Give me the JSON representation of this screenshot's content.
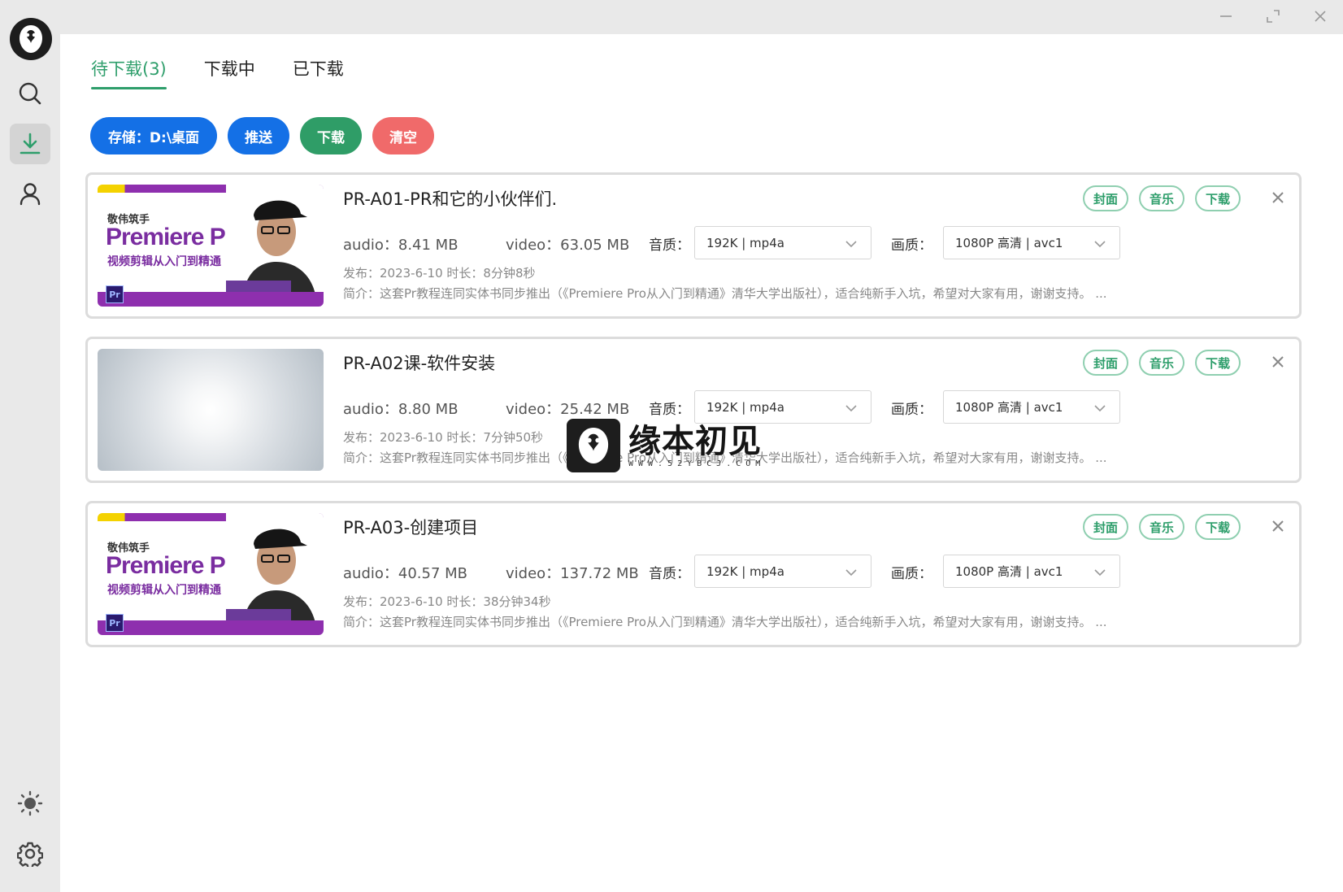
{
  "window": {
    "minimize_icon": "minimize-icon",
    "maximize_icon": "maximize-icon",
    "close_icon": "close-icon"
  },
  "sidebar": {
    "items": [
      {
        "name": "search",
        "icon": "search-icon"
      },
      {
        "name": "download",
        "icon": "download-icon",
        "active": true
      },
      {
        "name": "user",
        "icon": "user-icon"
      },
      {
        "name": "theme",
        "icon": "sun-icon"
      },
      {
        "name": "settings",
        "icon": "gear-icon"
      }
    ]
  },
  "tabs": [
    {
      "label": "待下载(3)",
      "active": true
    },
    {
      "label": "下载中",
      "active": false
    },
    {
      "label": "已下载",
      "active": false
    }
  ],
  "actions": {
    "storage": "存储：D:\\桌面",
    "push": "推送",
    "download": "下载",
    "clear": "清空"
  },
  "common": {
    "cover": "封面",
    "music": "音乐",
    "download": "下载",
    "quality_audio_label": "音质：",
    "quality_video_label": "画质：",
    "desc": "简介：这套Pr教程连同实体书同步推出（《Premiere Pro从入门到精通》清华大学出版社），适合纯新手入坑，希望对大家有用，谢谢支持。 ..."
  },
  "thumb_text": {
    "author": "敬伟筑手",
    "big": "Premiere Pro",
    "sub": "视频剪辑从入门到精通",
    "badge": "Pr"
  },
  "items": [
    {
      "title": "PR-A01-PR和它的小伙伴们.",
      "audio": "audio：8.41 MB",
      "video": "video：63.05 MB",
      "audio_quality": "192K | mp4a",
      "video_quality": "1080P 高清 | avc1",
      "meta": "发布：2023-6-10 时长：8分钟8秒",
      "thumb": "premiere"
    },
    {
      "title": "PR-A02课-软件安装",
      "audio": "audio：8.80 MB",
      "video": "video：25.42 MB",
      "audio_quality": "192K | mp4a",
      "video_quality": "1080P 高清 | avc1",
      "meta": "发布：2023-6-10 时长：7分钟50秒",
      "thumb": "blank"
    },
    {
      "title": "PR-A03-创建项目",
      "audio": "audio：40.57 MB",
      "video": "video：137.72 MB",
      "audio_quality": "192K | mp4a",
      "video_quality": "1080P 高清 | avc1",
      "meta": "发布：2023-6-10 时长：38分钟34秒",
      "thumb": "premiere"
    }
  ],
  "watermark": {
    "title": "缘本初见",
    "url": "WWW.52YBCJ.COM"
  },
  "colors": {
    "accent_green": "#2e9e6b",
    "blue": "#1470e6",
    "red": "#f06a6a"
  }
}
